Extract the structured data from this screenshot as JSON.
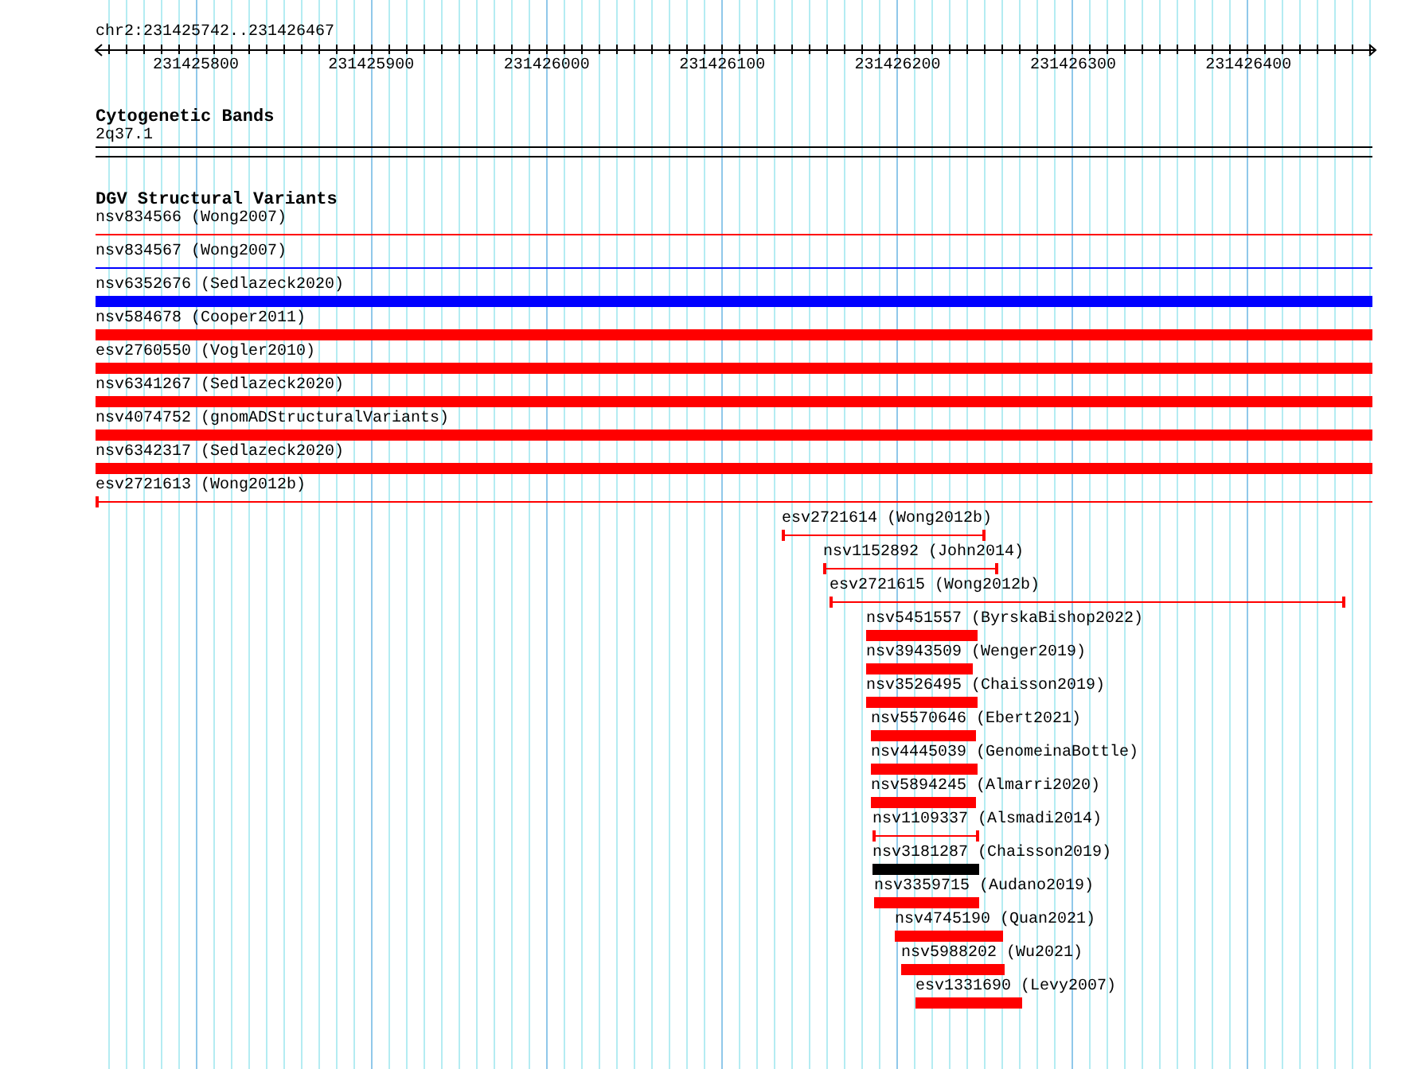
{
  "region": "chr2:231425742..231426467",
  "ruler": {
    "ticks": [
      "231425800",
      "231425900",
      "231426000",
      "231426100",
      "231426200",
      "231426300",
      "231426400"
    ]
  },
  "cytogenetic_bands": {
    "title": "Cytogenetic Bands",
    "band": "2q37.1"
  },
  "dgv_structural_variants": {
    "title": "DGV Structural Variants",
    "variants": [
      {
        "label": "nsv834566 (Wong2007)",
        "kind": "line",
        "color": "#ff0000"
      },
      {
        "label": "nsv834567 (Wong2007)",
        "kind": "line",
        "color": "#0000ff"
      },
      {
        "label": "nsv6352676 (Sedlazeck2020)",
        "kind": "bar",
        "color": "#0000ff"
      },
      {
        "label": "nsv584678 (Cooper2011)",
        "kind": "bar",
        "color": "#ff0000"
      },
      {
        "label": "esv2760550 (Vogler2010)",
        "kind": "bar",
        "color": "#ff0000"
      },
      {
        "label": "nsv6341267 (Sedlazeck2020)",
        "kind": "bar",
        "color": "#ff0000"
      },
      {
        "label": "nsv4074752 (gnomADStructuralVariants)",
        "kind": "bar",
        "color": "#ff0000"
      },
      {
        "label": "nsv6342317 (Sedlazeck2020)",
        "kind": "bar",
        "color": "#ff0000"
      },
      {
        "label": "esv2721613 (Wong2012b)",
        "kind": "interval",
        "color": "#ff0000"
      },
      {
        "label": "esv2721614 (Wong2012b)",
        "kind": "interval",
        "color": "#ff0000"
      },
      {
        "label": "nsv1152892 (John2014)",
        "kind": "interval",
        "color": "#ff0000"
      },
      {
        "label": "esv2721615 (Wong2012b)",
        "kind": "interval",
        "color": "#ff0000"
      },
      {
        "label": "nsv5451557 (ByrskaBishop2022)",
        "kind": "bar",
        "color": "#ff0000"
      },
      {
        "label": "nsv3943509 (Wenger2019)",
        "kind": "bar",
        "color": "#ff0000"
      },
      {
        "label": "nsv3526495 (Chaisson2019)",
        "kind": "bar",
        "color": "#ff0000"
      },
      {
        "label": "nsv5570646 (Ebert2021)",
        "kind": "bar",
        "color": "#ff0000"
      },
      {
        "label": "nsv4445039 (GenomeinaBottle)",
        "kind": "bar",
        "color": "#ff0000"
      },
      {
        "label": "nsv5894245 (Almarri2020)",
        "kind": "bar",
        "color": "#ff0000"
      },
      {
        "label": "nsv1109337 (Alsmadi2014)",
        "kind": "interval",
        "color": "#ff0000"
      },
      {
        "label": "nsv3181287 (Chaisson2019)",
        "kind": "bar",
        "color": "#000000"
      },
      {
        "label": "nsv3359715 (Audano2019)",
        "kind": "bar",
        "color": "#ff0000"
      },
      {
        "label": "nsv4745190 (Quan2021)",
        "kind": "bar",
        "color": "#ff0000"
      },
      {
        "label": "nsv5988202 (Wu2021)",
        "kind": "bar",
        "color": "#ff0000"
      },
      {
        "label": "esv1331690 (Levy2007)",
        "kind": "bar",
        "color": "#ff0000"
      }
    ]
  }
}
